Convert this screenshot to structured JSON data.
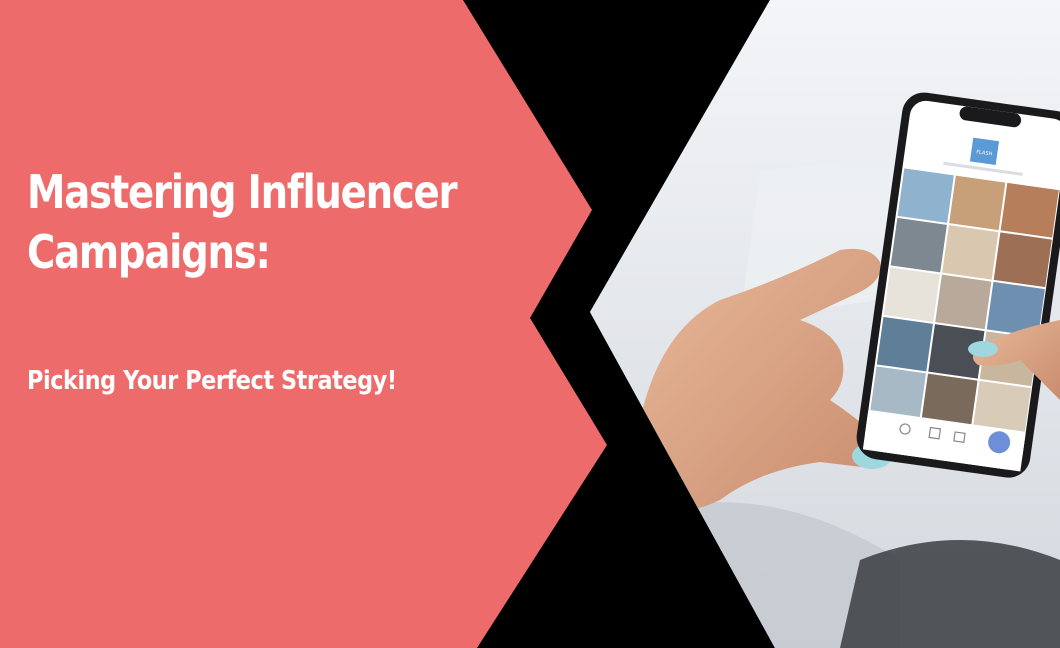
{
  "banner": {
    "title": "Mastering Influencer Campaigns:",
    "subtitle": "Picking Your Perfect Strategy!",
    "background_color": "#ee6b6b",
    "text_color": "#ffffff"
  },
  "photo": {
    "phone_profile_logo_text": "FLASH"
  },
  "colors": {
    "divider": "#000000",
    "nail_polish": "#9fd7df"
  }
}
